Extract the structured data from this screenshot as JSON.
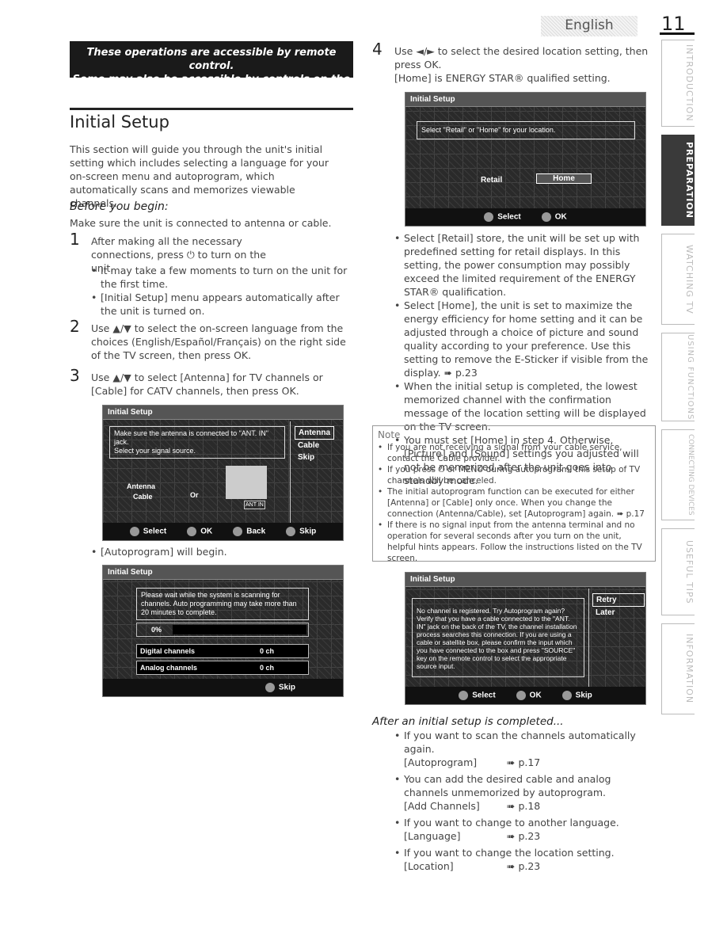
{
  "header": {
    "language": "English",
    "page_number": "11"
  },
  "banner": {
    "line1": "These operations are accessible by remote control.",
    "line2": "Some may also be accessible by controls on the main unit."
  },
  "section": {
    "title": "Initial Setup",
    "intro": "This section will guide you through the unit's initial setting which includes selecting a language for your on-screen menu and autoprogram, which automatically scans and memorizes viewable channels.",
    "before_title": "Before you begin:",
    "before_text": "Make sure the unit is connected to antenna or cable."
  },
  "steps": [
    {
      "num": "1",
      "text": "After making all the necessary connections, press ⏻ to turn on the unit.",
      "bullets": [
        "It may take a few moments to turn on the unit for the first time.",
        "[Initial Setup] menu appears automatically after the unit is turned on."
      ]
    },
    {
      "num": "2",
      "text": "Use ▲/▼ to select the on-screen language from the choices (English/Español/Français) on the right side of the TV screen, then press OK."
    },
    {
      "num": "3",
      "text": "Use ▲/▼ to select [Antenna] for TV channels or [Cable] for CATV channels, then press OK.",
      "after": "[Autoprogram] will begin."
    },
    {
      "num": "4",
      "text": "Use ◄/► to select the desired location setting, then press OK.",
      "note": "[Home] is ENERGY STAR® qualified setting.",
      "bullets": [
        "Select [Retail] store, the unit will be set up with predefined setting for retail displays. In this setting, the power consumption may possibly exceed the limited requirement of the ENERGY STAR® qualification.",
        "Select [Home], the unit is set to maximize the energy efficiency for home setting and it can be adjusted through a choice of picture and sound quality according to your preference. Use this setting to remove the E-Sticker if visible from the display. ➠ p.23",
        "When the initial setup is completed, the lowest memorized channel with the confirmation message of the location setting will be displayed on the TV screen.",
        "You must set [Home] in step 4. Otherwise, [Picture] and [Sound] settings you adjusted will not be memorized after the unit goes into standby mode."
      ]
    }
  ],
  "screen_signal": {
    "title": "Initial Setup",
    "msg1": "Make sure the antenna is connected to \"ANT. IN\" jack.",
    "msg2": "Select your signal source.",
    "options": [
      "Antenna",
      "Cable",
      "Skip"
    ],
    "antenna": "Antenna",
    "cable": "Cable",
    "or": "Or",
    "ant_in": "ANT IN",
    "footer": [
      "Select",
      "OK",
      "Back",
      "Skip"
    ]
  },
  "screen_scan": {
    "title": "Initial Setup",
    "msg": "Please wait while the system is scanning for channels. Auto programming may take more than 20 minutes to complete.",
    "progress": "0%",
    "progress_value": 0,
    "rows": [
      {
        "label": "Digital channels",
        "value": "0 ch"
      },
      {
        "label": "Analog channels",
        "value": "0 ch"
      }
    ],
    "footer": [
      "Skip"
    ]
  },
  "screen_location": {
    "title": "Initial Setup",
    "msg": "Select \"Retail\" or \"Home\" for your location.",
    "options": [
      "Retail",
      "Home"
    ],
    "footer": [
      "Select",
      "OK"
    ]
  },
  "screen_nochannel": {
    "title": "Initial Setup",
    "msg": "No channel is registered. Try Autoprogram again? Verify that you have a cable connected to the \"ANT. IN\" jack on the back of the TV, the channel installation process searches this connection. If you are using a cable or satellite box, please confirm the input which you have connected to the box and press \"SOURCE\" key on the remote control to select the appropriate source input.",
    "options": [
      "Retry",
      "Later"
    ],
    "footer": [
      "Select",
      "OK",
      "Skip"
    ]
  },
  "note": {
    "title": "Note",
    "items": [
      "If you are not receiving a signal from your cable service, contact the Cable provider.",
      "If you press ⏻ or MENU during autoprogram, this setup of TV channels will be canceled.",
      "The initial autoprogram function can be executed for either [Antenna] or [Cable] only once. When you change the connection (Antenna/Cable), set [Autoprogram] again. ➠ p.17",
      "If there is no signal input from the antenna terminal and no operation for several seconds after you turn on the unit, helpful hints appears. Follow the instructions listed on the TV screen."
    ]
  },
  "after": {
    "title": "After an initial setup is completed...",
    "items": [
      {
        "text": "If you want to scan the channels automatically again.",
        "ref": "[Autoprogram]",
        "page": "➠ p.17"
      },
      {
        "text": "You can add the desired cable and analog channels unmemorized by autoprogram.",
        "ref": "[Add Channels]",
        "page": "➠ p.18"
      },
      {
        "text": "If you want to change to another language.",
        "ref": "[Language]",
        "page": "➠ p.23"
      },
      {
        "text": "If you want to change the location setting.",
        "ref": "[Location]",
        "page": "➠ p.23"
      }
    ]
  },
  "tabs": [
    {
      "label": "INTRODUCTION",
      "active": false
    },
    {
      "label": "PREPARATION",
      "active": true
    },
    {
      "label": "WATCHING TV",
      "active": false
    },
    {
      "label": "USING FUNCTIONS",
      "active": false
    },
    {
      "label": "CONNECTING DEVICES",
      "active": false
    },
    {
      "label": "USEFUL TIPS",
      "active": false
    },
    {
      "label": "INFORMATION",
      "active": false
    }
  ]
}
